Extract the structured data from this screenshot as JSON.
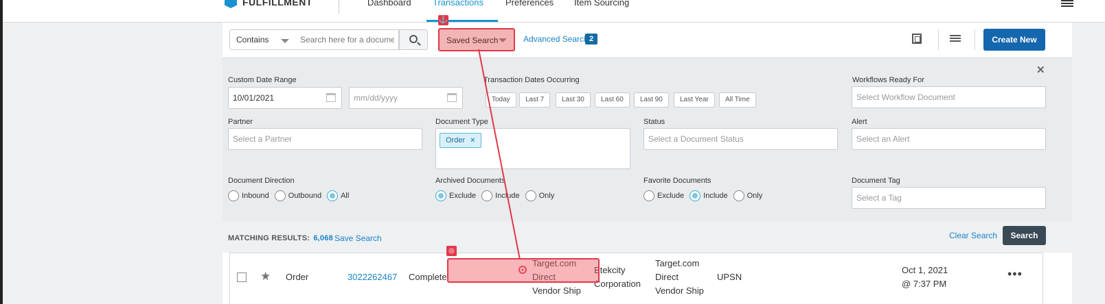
{
  "nav": {
    "brand": "FULFILLMENT",
    "items": [
      "Dashboard",
      "Transactions",
      "Preferences",
      "Item Sourcing"
    ],
    "active_index": 1
  },
  "searchbar": {
    "match_mode": "Contains",
    "search_placeholder": "Search here for a document",
    "saved_search_label": "Saved Search",
    "advanced_label": "Advanced Search",
    "advanced_count": "2",
    "create_label": "Create New"
  },
  "filters": {
    "custom_date_label": "Custom Date Range",
    "date_from": "10/01/2021",
    "date_to_placeholder": "mm/dd/yyyy",
    "occurring_label": "Transaction Dates Occurring",
    "occurring_options": [
      "Today",
      "Last 7",
      "Last 30",
      "Last 60",
      "Last 90",
      "Last Year",
      "All Time"
    ],
    "workflows_label": "Workflows Ready For",
    "workflows_placeholder": "Select Workflow Document",
    "partner_label": "Partner",
    "partner_placeholder": "Select a Partner",
    "doctype_label": "Document Type",
    "doctype_chip": "Order",
    "status_label": "Status",
    "status_placeholder": "Select a Document Status",
    "alert_label": "Alert",
    "alert_placeholder": "Select an Alert",
    "direction_label": "Document Direction",
    "direction_options": [
      "Inbound",
      "Outbound",
      "All"
    ],
    "direction_selected": "All",
    "archived_label": "Archived Documents",
    "archived_options": [
      "Exclude",
      "Include",
      "Only"
    ],
    "archived_selected": "Exclude",
    "favorite_label": "Favorite Documents",
    "favorite_options": [
      "Exclude",
      "Include",
      "Only"
    ],
    "favorite_selected": "Include",
    "tag_label": "Document Tag",
    "tag_placeholder": "Select a Tag"
  },
  "results": {
    "label": "MATCHING RESULTS:",
    "count": "6,068",
    "save_label": "Save Search",
    "clear_label": "Clear Search",
    "search_label": "Search"
  },
  "row": {
    "doc_type": "Order",
    "doc_number": "3022262467",
    "status": "Complete",
    "sender_line1": "Target.com",
    "sender_line2": "Direct",
    "sender_line3": "Vendor Ship",
    "vendor_line1": "Etekcity",
    "vendor_line2": "Corporation",
    "receiver_line1": "Target.com",
    "receiver_line2": "Direct",
    "receiver_line3": "Vendor Ship",
    "carrier": "UPSN",
    "date": "Oct 1, 2021",
    "time": "@ 7:37 PM"
  },
  "colors": {
    "brand_blue": "#1a91d1",
    "primary_button": "#1466ad",
    "highlight_red": "#e0394a"
  }
}
